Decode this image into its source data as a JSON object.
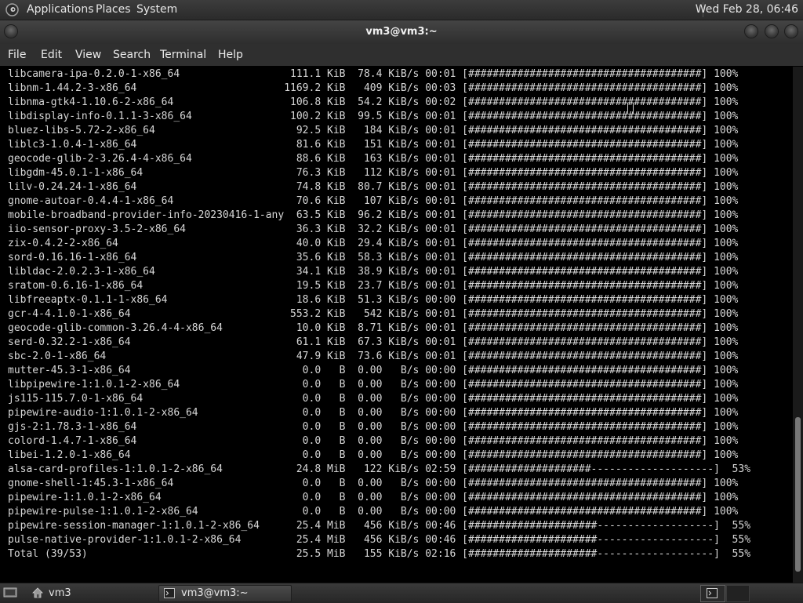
{
  "top_panel": {
    "applications": "Applications",
    "places": "Places",
    "system": "System",
    "clock": "Wed Feb 28, 06:46"
  },
  "window": {
    "title": "vm3@vm3:~"
  },
  "menubar": {
    "file": "File",
    "edit": "Edit",
    "view": "View",
    "search": "Search",
    "terminal": "Terminal",
    "help": "Help"
  },
  "terminal": {
    "lines": [
      "libcamera-ipa-0.2.0-1-x86_64                  111.1 KiB  78.4 KiB/s 00:01 [######################################] 100%",
      "libnm-1.44.2-3-x86_64                        1169.2 KiB   409 KiB/s 00:03 [######################################] 100%",
      "libnma-gtk4-1.10.6-2-x86_64                   106.8 KiB  54.2 KiB/s 00:02 [######################################] 100%",
      "libdisplay-info-0.1.1-3-x86_64                100.2 KiB  99.5 KiB/s 00:01 [######################################] 100%",
      "bluez-libs-5.72-2-x86_64                       92.5 KiB   184 KiB/s 00:01 [######################################] 100%",
      "liblc3-1.0.4-1-x86_64                          81.6 KiB   151 KiB/s 00:01 [######################################] 100%",
      "geocode-glib-2-3.26.4-4-x86_64                 88.6 KiB   163 KiB/s 00:01 [######################################] 100%",
      "libgdm-45.0.1-1-x86_64                         76.3 KiB   112 KiB/s 00:01 [######################################] 100%",
      "lilv-0.24.24-1-x86_64                          74.8 KiB  80.7 KiB/s 00:01 [######################################] 100%",
      "gnome-autoar-0.4.4-1-x86_64                    70.6 KiB   107 KiB/s 00:01 [######################################] 100%",
      "mobile-broadband-provider-info-20230416-1-any  63.5 KiB  96.2 KiB/s 00:01 [######################################] 100%",
      "iio-sensor-proxy-3.5-2-x86_64                  36.3 KiB  32.2 KiB/s 00:01 [######################################] 100%",
      "zix-0.4.2-2-x86_64                             40.0 KiB  29.4 KiB/s 00:01 [######################################] 100%",
      "sord-0.16.16-1-x86_64                          35.6 KiB  58.3 KiB/s 00:01 [######################################] 100%",
      "libldac-2.0.2.3-1-x86_64                       34.1 KiB  38.9 KiB/s 00:01 [######################################] 100%",
      "sratom-0.6.16-1-x86_64                         19.5 KiB  23.7 KiB/s 00:01 [######################################] 100%",
      "libfreeaptx-0.1.1-1-x86_64                     18.6 KiB  51.3 KiB/s 00:00 [######################################] 100%",
      "gcr-4-4.1.0-1-x86_64                          553.2 KiB   542 KiB/s 00:01 [######################################] 100%",
      "geocode-glib-common-3.26.4-4-x86_64            10.0 KiB  8.71 KiB/s 00:01 [######################################] 100%",
      "serd-0.32.2-1-x86_64                           61.1 KiB  67.3 KiB/s 00:01 [######################################] 100%",
      "sbc-2.0-1-x86_64                               47.9 KiB  73.6 KiB/s 00:01 [######################################] 100%",
      "mutter-45.3-1-x86_64                            0.0   B  0.00   B/s 00:00 [######################################] 100%",
      "libpipewire-1:1.0.1-2-x86_64                    0.0   B  0.00   B/s 00:00 [######################################] 100%",
      "js115-115.7.0-1-x86_64                          0.0   B  0.00   B/s 00:00 [######################################] 100%",
      "pipewire-audio-1:1.0.1-2-x86_64                 0.0   B  0.00   B/s 00:00 [######################################] 100%",
      "gjs-2:1.78.3-1-x86_64                           0.0   B  0.00   B/s 00:00 [######################################] 100%",
      "colord-1.4.7-1-x86_64                           0.0   B  0.00   B/s 00:00 [######################################] 100%",
      "libei-1.2.0-1-x86_64                            0.0   B  0.00   B/s 00:00 [######################################] 100%",
      "alsa-card-profiles-1:1.0.1-2-x86_64            24.8 MiB   122 KiB/s 02:59 [####################--------------------]  53%",
      "gnome-shell-1:45.3-1-x86_64                     0.0   B  0.00   B/s 00:00 [######################################] 100%",
      "pipewire-1:1.0.1-2-x86_64                       0.0   B  0.00   B/s 00:00 [######################################] 100%",
      "pipewire-pulse-1:1.0.1-2-x86_64                 0.0   B  0.00   B/s 00:00 [######################################] 100%",
      "pipewire-session-manager-1:1.0.1-2-x86_64      25.4 MiB   456 KiB/s 00:46 [#####################-------------------]  55%",
      "pulse-native-provider-1:1.0.1-2-x86_64         25.4 MiB   456 KiB/s 00:46 [#####################-------------------]  55%",
      "Total (39/53)                                  25.5 MiB   155 KiB/s 02:16 [#####################-------------------]  55%"
    ],
    "scroll_position": 0.97,
    "scroll_visible_fraction": 0.3
  },
  "bottom_panel": {
    "workspace_task_label": "vm3",
    "terminal_task_label": "vm3@vm3:~"
  },
  "icons": {
    "distro_logo": "gentoo-logo-icon",
    "show_desktop": "show-desktop-icon",
    "home_folder": "home-folder-icon",
    "terminal": "terminal-icon"
  },
  "colors": {
    "panel": "#333333",
    "terminal_bg": "#000000",
    "terminal_fg": "#d7d7d7"
  }
}
